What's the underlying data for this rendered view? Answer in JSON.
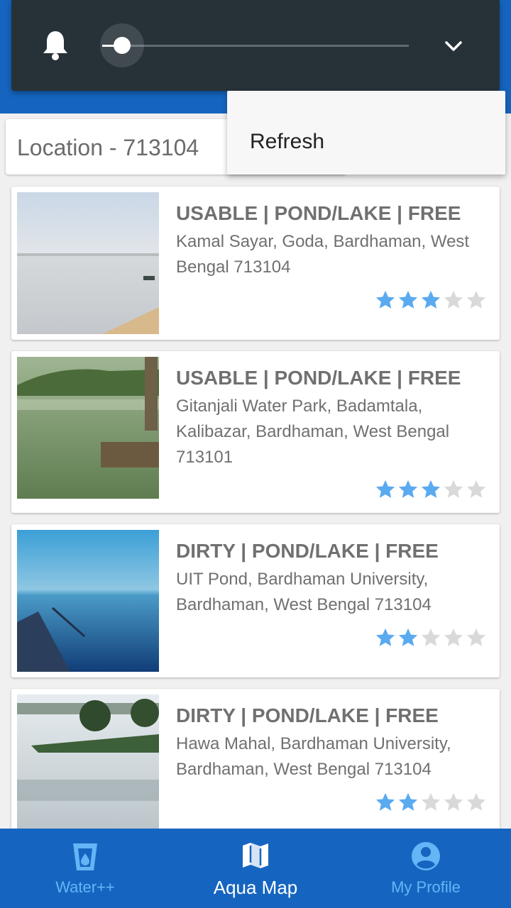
{
  "location": {
    "label": "Location - 713104"
  },
  "menu": {
    "refresh_label": "Refresh"
  },
  "brightness": {
    "level": 0.07
  },
  "colors": {
    "primary": "#1565c0",
    "star_on": "#5aaaf0",
    "star_off": "#d9d9d9",
    "shade": "#263238"
  },
  "places": [
    {
      "title": "USABLE | POND/LAKE | FREE",
      "address": "Kamal Sayar, Goda, Bardhaman, West Bengal 713104",
      "rating": 3
    },
    {
      "title": "USABLE | POND/LAKE | FREE",
      "address": "Gitanjali Water Park, Badamtala, Kalibazar, Bardhaman, West Bengal 713101",
      "rating": 3
    },
    {
      "title": "DIRTY | POND/LAKE | FREE",
      "address": "UIT Pond, Bardhaman University, Bardhaman, West Bengal 713104",
      "rating": 2
    },
    {
      "title": "DIRTY | POND/LAKE | FREE",
      "address": "Hawa Mahal, Bardhaman University, Bardhaman, West Bengal 713104",
      "rating": 2
    }
  ],
  "nav": {
    "items": [
      {
        "label": "Water++",
        "icon": "glass-icon",
        "active": false
      },
      {
        "label": "Aqua Map",
        "icon": "map-icon",
        "active": true
      },
      {
        "label": "My Profile",
        "icon": "account-icon",
        "active": false
      }
    ]
  }
}
